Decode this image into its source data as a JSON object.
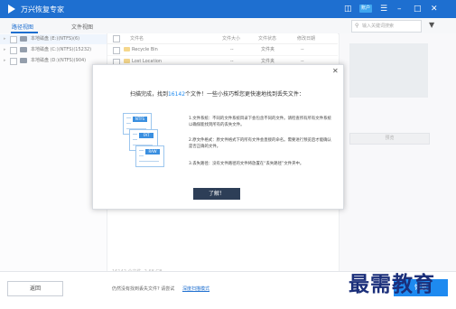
{
  "app": {
    "title": "万兴恢复专家",
    "account_label": "账户"
  },
  "titlebar_icons": [
    "book-icon",
    "account-badge",
    "menu-icon",
    "minimize-icon",
    "maximize-icon",
    "close-icon"
  ],
  "tabs": [
    {
      "label": "路径视图",
      "active": true
    },
    {
      "label": "文件视图",
      "active": false
    }
  ],
  "search": {
    "placeholder": "输入关键词搜索"
  },
  "tree": [
    {
      "label": "本地磁盘 (E:)(NTFS)(6)",
      "selected": true
    },
    {
      "label": "本地磁盘 (C:)(NTFS)(15232)",
      "selected": false
    },
    {
      "label": "本地磁盘 (D:)(NTFS)(904)",
      "selected": false
    }
  ],
  "table": {
    "headers": [
      "文件名",
      "文件大小",
      "文件状态",
      "修改日期"
    ],
    "rows": [
      {
        "name": "Recycle Bin",
        "size": "--",
        "status": "文件夹",
        "date": "--"
      },
      {
        "name": "Lost Location",
        "size": "--",
        "status": "文件夹",
        "date": "--"
      }
    ]
  },
  "preview": {
    "button_label": "预览"
  },
  "status": {
    "scan_summary": "16142 个文件, 2.68 GB"
  },
  "footer": {
    "back_label": "返回",
    "hint_text": "仍然没有找到丢失文件? 请尝试",
    "hint_link": "深度扫描模式",
    "recover_label": "恢复"
  },
  "dialog": {
    "title_prefix": "扫描完成，找到",
    "title_count": "16142",
    "title_suffix": "个文件！一些小技巧帮您更快速地找到丢失文件：",
    "doc_badges": [
      "NTFS",
      "FAT",
      "RAW"
    ],
    "tips": [
      "1.文件系统：不同的文件系统目录下会包含不同的文件。请检查所有所有文件系统以确保能找到所有的丢失文件。",
      "2.原文件格式：原文件格式下的所有文件会直接的命名。需要进行预览后才能确认是否正确的文件。",
      "3.丢失路径：没有文件路径的文件将放置在“丢失路径”文件夹中。"
    ],
    "ok_label": "了解！"
  },
  "watermark": "最需教育",
  "colors": {
    "accent": "#1e6fd0",
    "button_dark": "#2d3e57",
    "highlight": "#1e8af0"
  }
}
